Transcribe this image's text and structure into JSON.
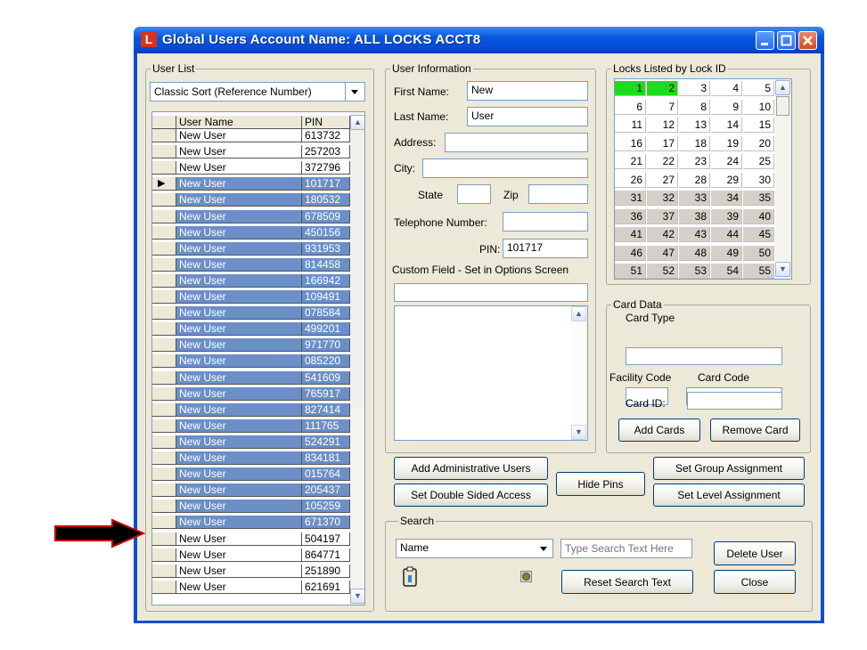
{
  "window": {
    "title": "Global Users Account Name: ALL LOCKS ACCT8"
  },
  "user_list": {
    "group_label": "User List",
    "sort_value": "Classic Sort (Reference Number)",
    "columns": [
      "User Name",
      "PIN"
    ],
    "current_row_marker": "▶",
    "rows": [
      {
        "name": "New User",
        "pin": "613732",
        "selected": false
      },
      {
        "name": "New User",
        "pin": "257203",
        "selected": false
      },
      {
        "name": "New User",
        "pin": "372796",
        "selected": false
      },
      {
        "name": "New User",
        "pin": "101717",
        "selected": true,
        "current": true
      },
      {
        "name": "New User",
        "pin": "180532",
        "selected": true
      },
      {
        "name": "New User",
        "pin": "678509",
        "selected": true
      },
      {
        "name": "New User",
        "pin": "450156",
        "selected": true
      },
      {
        "name": "New User",
        "pin": "931953",
        "selected": true
      },
      {
        "name": "New User",
        "pin": "814458",
        "selected": true
      },
      {
        "name": "New User",
        "pin": "166942",
        "selected": true
      },
      {
        "name": "New User",
        "pin": "109491",
        "selected": true
      },
      {
        "name": "New User",
        "pin": "078584",
        "selected": true
      },
      {
        "name": "New User",
        "pin": "499201",
        "selected": true
      },
      {
        "name": "New User",
        "pin": "971770",
        "selected": true
      },
      {
        "name": "New User",
        "pin": "085220",
        "selected": true
      },
      {
        "name": "New User",
        "pin": "541609",
        "selected": true
      },
      {
        "name": "New User",
        "pin": "765917",
        "selected": true
      },
      {
        "name": "New User",
        "pin": "827414",
        "selected": true
      },
      {
        "name": "New User",
        "pin": "111765",
        "selected": true
      },
      {
        "name": "New User",
        "pin": "524291",
        "selected": true
      },
      {
        "name": "New User",
        "pin": "834181",
        "selected": true
      },
      {
        "name": "New User",
        "pin": "015764",
        "selected": true
      },
      {
        "name": "New User",
        "pin": "205437",
        "selected": true
      },
      {
        "name": "New User",
        "pin": "105259",
        "selected": true
      },
      {
        "name": "New User",
        "pin": "671370",
        "selected": true
      },
      {
        "name": "New User",
        "pin": "504197",
        "selected": false
      },
      {
        "name": "New User",
        "pin": "864771",
        "selected": false
      },
      {
        "name": "New User",
        "pin": "251890",
        "selected": false
      },
      {
        "name": "New User",
        "pin": "621691",
        "selected": false
      }
    ]
  },
  "user_info": {
    "group_label": "User Information",
    "first_name_label": "First Name:",
    "first_name_value": "New",
    "last_name_label": "Last Name:",
    "last_name_value": "User",
    "address_label": "Address:",
    "address_value": "",
    "city_label": "City:",
    "city_value": "",
    "state_label": "State",
    "state_value": "",
    "zip_label": "Zip",
    "zip_value": "",
    "phone_label": "Telephone Number:",
    "phone_value": "",
    "pin_label": "PIN:",
    "pin_value": "101717",
    "custom_label": "Custom Field - Set in Options Screen",
    "custom_value": "",
    "notes_value": ""
  },
  "locks": {
    "group_label": "Locks Listed by Lock ID",
    "rows": [
      [
        "1",
        "2",
        "3",
        "4",
        "5"
      ],
      [
        "6",
        "7",
        "8",
        "9",
        "10"
      ],
      [
        "11",
        "12",
        "13",
        "14",
        "15"
      ],
      [
        "16",
        "17",
        "18",
        "19",
        "20"
      ],
      [
        "21",
        "22",
        "23",
        "24",
        "25"
      ],
      [
        "26",
        "27",
        "28",
        "29",
        "30"
      ],
      [
        "31",
        "32",
        "33",
        "34",
        "35"
      ],
      [
        "36",
        "37",
        "38",
        "39",
        "40"
      ],
      [
        "41",
        "42",
        "43",
        "44",
        "45"
      ],
      [
        "46",
        "47",
        "48",
        "49",
        "50"
      ],
      [
        "51",
        "52",
        "53",
        "54",
        "55"
      ]
    ],
    "highlighted": [
      "1",
      "2"
    ],
    "highlight_color": "#1fdb1f"
  },
  "card_data": {
    "group_label": "Card Data",
    "card_type_label": "Card Type",
    "card_type_value": "",
    "facility_code_label": "Facility Code",
    "facility_code_value": "",
    "card_code_label": "Card Code",
    "card_code_value": "",
    "card_id_label": "Card ID:",
    "card_id_value": "",
    "add_cards_button": "Add Cards",
    "remove_card_button": "Remove Card"
  },
  "actions": {
    "add_admin_button": "Add Administrative Users",
    "double_sided_button": "Set Double Sided Access",
    "hide_pins_button": "Hide Pins",
    "group_assignment_button": "Set Group Assignment",
    "level_assignment_button": "Set Level Assignment"
  },
  "search": {
    "group_label": "Search",
    "field_value": "Name",
    "text_placeholder": "Type Search Text Here",
    "reset_button": "Reset Search Text",
    "delete_user_button": "Delete User",
    "close_button": "Close"
  },
  "colors": {
    "titlebar": "#0757e0",
    "selection": "#6b8fc6",
    "background": "#ece9d8",
    "arrow": "#000000",
    "arrow_outline": "#cc0000"
  }
}
